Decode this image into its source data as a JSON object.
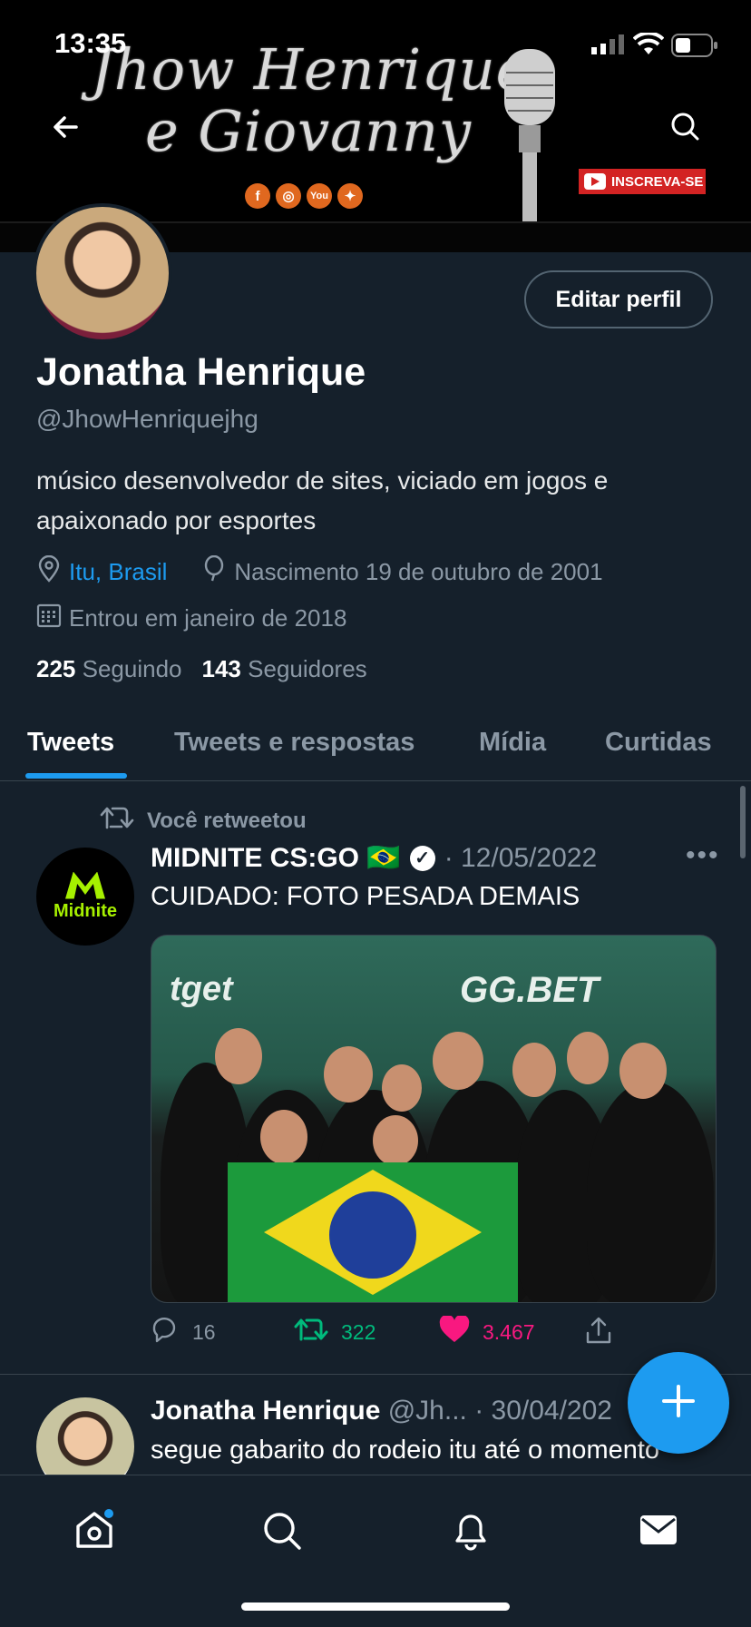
{
  "status_bar": {
    "time": "13:35"
  },
  "banner": {
    "script_line1": "Jhow Henrique",
    "script_line2": "e Giovanny",
    "social_icons": [
      "facebook-icon",
      "instagram-icon",
      "youtube-icon",
      "twitter-icon"
    ],
    "subscribe_label": "INSCREVA-SE"
  },
  "header": {
    "back_icon": "back-arrow-icon",
    "search_icon": "search-icon"
  },
  "profile": {
    "edit_label": "Editar perfil",
    "name": "Jonatha Henrique",
    "handle": "@JhowHenriquejhg",
    "bio": "músico desenvolvedor de sites, viciado em jogos e apaixonado por esportes",
    "location": "Itu, Brasil",
    "birthday": "Nascimento 19 de outubro de 2001",
    "joined": "Entrou em janeiro de 2018",
    "following_count": "225",
    "following_label": "Seguindo",
    "followers_count": "143",
    "followers_label": "Seguidores"
  },
  "tabs": [
    {
      "label": "Tweets",
      "active": true
    },
    {
      "label": "Tweets e respostas",
      "active": false
    },
    {
      "label": "Mídia",
      "active": false
    },
    {
      "label": "Curtidas",
      "active": false
    }
  ],
  "tweets": [
    {
      "retweet_label": "Você retweetou",
      "author": "MIDNITE CS:GO 🇧🇷",
      "date": "· 12/05/2022",
      "text": "CUIDADO: FOTO PESADA DEMAIS",
      "avatar_text": "Midnite",
      "photo_texts": {
        "left": "tget",
        "right": "GG.BET"
      },
      "replies": "16",
      "retweets": "322",
      "likes": "3.467"
    },
    {
      "author": "Jonatha Henrique",
      "handle_date": "@Jh... · 30/04/202",
      "text": "segue gabarito do rodeio itu até o momento"
    }
  ],
  "colors": {
    "accent": "#1d9bf0",
    "retweet": "#00ba7c",
    "like": "#f91880",
    "background": "#15202b"
  },
  "bottom_nav": [
    "home-icon",
    "search-icon",
    "notifications-icon",
    "messages-icon"
  ]
}
